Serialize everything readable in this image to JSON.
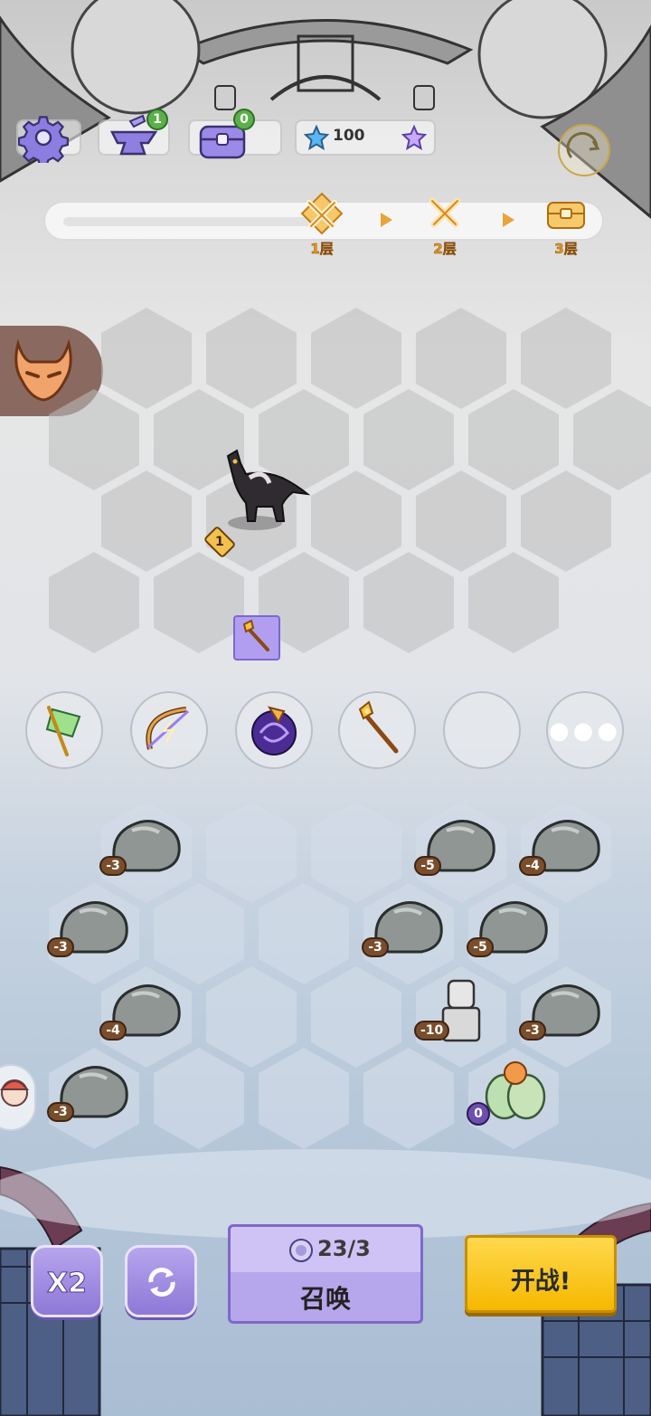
{
  "topbar": {
    "settings_icon": "gear-icon",
    "anvil_badge": "1",
    "chest_badge": "0",
    "stars": "100"
  },
  "stage_progress": {
    "floors": [
      {
        "label": "1层",
        "icon": "crossed-swords-icon"
      },
      {
        "label": "2层",
        "icon": "crossed-swords-icon"
      },
      {
        "label": "3层",
        "icon": "treasure-chest-icon"
      }
    ]
  },
  "enemy_board": {
    "unit_level": "1",
    "item_icon": "golden-staff-icon"
  },
  "abilities": [
    {
      "icon": "green-banner-icon"
    },
    {
      "icon": "lightning-bow-icon"
    },
    {
      "icon": "dark-vortex-icon"
    },
    {
      "icon": "golden-staff-icon"
    },
    {
      "icon": "empty-slot"
    },
    {
      "icon": "more-icon"
    }
  ],
  "player_board": {
    "costs": {
      "r0c1": "-3",
      "r0c4": "-5",
      "r0c5": "-4",
      "r1c0": "-3",
      "r1c3": "-3",
      "r1c4": "-5",
      "r2c1": "-4",
      "r2c4": "-10",
      "r2c5": "-3",
      "r3c0": "-3",
      "r3c4": "0"
    }
  },
  "controls": {
    "speed_label": "X2",
    "summon_count": "23/3",
    "summon_label": "召唤",
    "fight_label": "开战!"
  }
}
